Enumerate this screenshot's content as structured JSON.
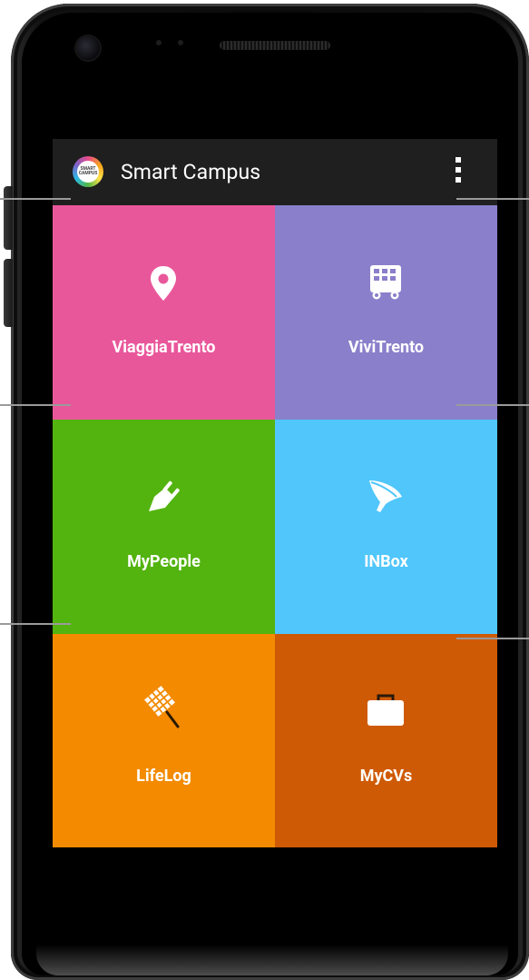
{
  "app": {
    "title": "Smart Campus",
    "icon_text": "SMART CAMPUS",
    "icon": "smart-campus-logo",
    "menu_icon": "overflow-menu-icon"
  },
  "tiles": [
    {
      "label": "ViaggiaTrento",
      "icon": "location-pin-icon",
      "color": "#e9579b"
    },
    {
      "label": "ViviTrento",
      "icon": "tram-icon",
      "color": "#8a7fca"
    },
    {
      "label": "MyPeople",
      "icon": "plug-icon",
      "color": "#53b30f"
    },
    {
      "label": "INBox",
      "icon": "funnel-icon",
      "color": "#50c6fb"
    },
    {
      "label": "LifeLog",
      "icon": "net-icon",
      "color": "#f38a00"
    },
    {
      "label": "MyCVs",
      "icon": "briefcase-icon",
      "color": "#cf5a05"
    }
  ],
  "colors": {
    "action_bar": "#1f1f1f",
    "phone_body": "#0a0a0a"
  }
}
